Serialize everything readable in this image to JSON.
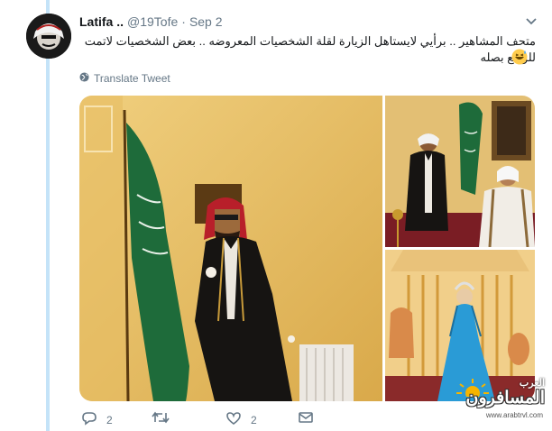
{
  "tweet": {
    "author_name": "Latifa ..",
    "handle": "@19Tofe",
    "separator": "·",
    "date": "Sep 2",
    "text": "متحف المشاهير .. برأيي لايستاهل الزيارة لقلة الشخصيات المعروضه .. بعض الشخصيات لاتمت للواقع بصله",
    "emoji": "grinning-sweat-emoji",
    "translate_label": "Translate Tweet"
  },
  "actions": {
    "reply_count": "2",
    "retweet_count": "",
    "like_count": "2"
  },
  "watermark": {
    "top": "العرب",
    "main": "المسافرون",
    "url": "www.arabtrvl.com"
  },
  "icons": {
    "caret": "chevron-down-icon",
    "globe": "globe-icon",
    "reply": "reply-icon",
    "retweet": "retweet-icon",
    "like": "heart-icon",
    "dm": "envelope-icon"
  },
  "colors": {
    "text": "#14171a",
    "muted": "#657786",
    "thread_line": "#c4e3f8",
    "flag_green": "#1e6b3a"
  }
}
